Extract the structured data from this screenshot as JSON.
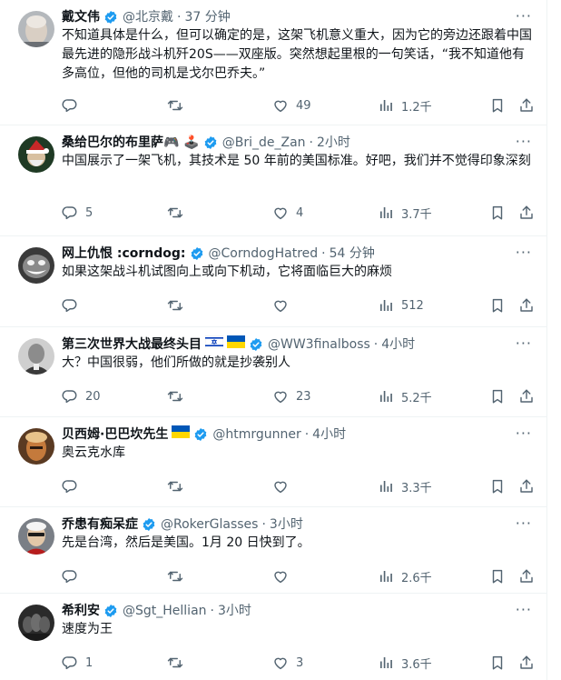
{
  "tweets": [
    {
      "name": "戴文伟",
      "handle": "@北京戴",
      "time": "37 分钟",
      "text": "不知道具体是什么，但可以确定的是，这架飞机意义重大，因为它的旁边还跟着中国最先进的隐形战斗机歼20S——双座版。突然想起里根的一句笑话，“我不知道他有多高位，但他的司机是戈尔巴乔夫。”",
      "replies": "",
      "retweets": "",
      "likes": "49",
      "views": "1.2千"
    },
    {
      "name": "桑给巴尔的布里萨🎮 🕹️",
      "handle": "@Bri_de_Zan",
      "time": "2小时",
      "text": "中国展示了一架飞机，其技术是 50 年前的美国标准。好吧，我们并不觉得印象深刻",
      "replies": "5",
      "retweets": "",
      "likes": "4",
      "views": "3.7千"
    },
    {
      "name": "网上仇恨 :corndog:",
      "handle": "@CorndogHatred",
      "time": "54 分钟",
      "text": "如果这架战斗机试图向上或向下机动，它将面临巨大的麻烦",
      "replies": "",
      "retweets": "",
      "likes": "",
      "views": "512"
    },
    {
      "name": "第三次世界大战最终头目",
      "handle": "@WW3finalboss",
      "time": "4小时",
      "text": "大？中国很弱，他们所做的就是抄袭别人",
      "replies": "20",
      "retweets": "",
      "likes": "23",
      "views": "5.2千"
    },
    {
      "name": "贝西姆·巴巴坎先生",
      "handle": "@htmrgunner",
      "time": "4小时",
      "text": "奥云克水库",
      "replies": "",
      "retweets": "",
      "likes": "",
      "views": "3.3千"
    },
    {
      "name": "乔患有痴呆症",
      "handle": "@RokerGlasses",
      "time": "3小时",
      "text": "先是台湾，然后是美国。1月 20 日快到了。",
      "replies": "",
      "retweets": "",
      "likes": "",
      "views": "2.6千"
    },
    {
      "name": "希利安",
      "handle": "@Sgt_Hellian",
      "time": "3小时",
      "text": "速度为王",
      "replies": "1",
      "retweets": "",
      "likes": "3",
      "views": "3.6千"
    }
  ],
  "colors": {
    "verified": "#1d9bf0",
    "secondary": "#536471",
    "text": "#0f1419",
    "divider": "#eff3f4"
  },
  "icons": [
    "reply-icon",
    "retweet-icon",
    "like-icon",
    "views-icon",
    "bookmark-icon",
    "share-icon",
    "verified-badge-icon",
    "more-icon"
  ]
}
